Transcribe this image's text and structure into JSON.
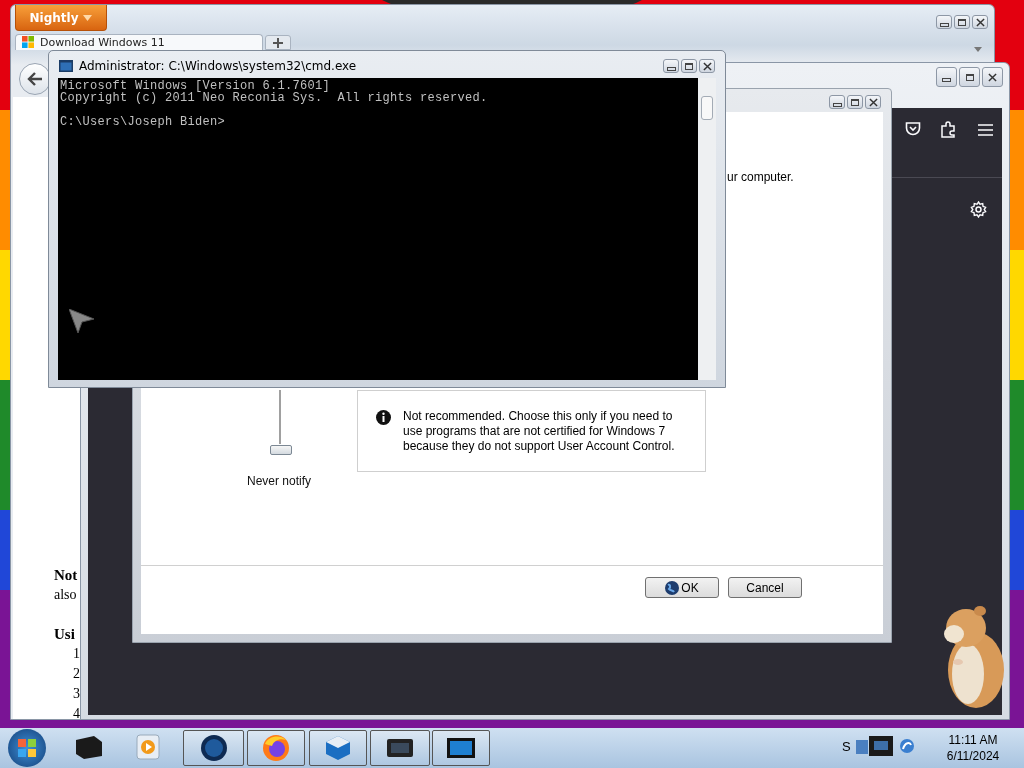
{
  "browser": {
    "menu_button": "Nightly",
    "tab": {
      "title": "Download Windows 11"
    },
    "page_text": [
      {
        "text": "Not",
        "kind": "heading"
      },
      {
        "text": "also",
        "kind": "body"
      },
      {
        "text": "Usi",
        "kind": "heading"
      },
      {
        "text": "1",
        "kind": "number"
      },
      {
        "text": "2",
        "kind": "number"
      },
      {
        "text": "3",
        "kind": "number"
      },
      {
        "text": "4",
        "kind": "number"
      }
    ]
  },
  "uac_dialog": {
    "visible_text": "ur computer.",
    "slider": {
      "label": "Never notify"
    },
    "info": "Not recommended. Choose this only if you need to use programs that are not certified for Windows 7 because they do not support User Account Control.",
    "buttons": [
      {
        "label": "OK",
        "kind": "shield"
      },
      {
        "label": "Cancel",
        "kind": "plain"
      }
    ]
  },
  "cmd": {
    "title": "Administrator: C:\\Windows\\system32\\cmd.exe",
    "output": [
      "Microsoft Windows [Version 6.1.7601]",
      "Copyright (c) 2011 Neo Reconia Sys.  All rights reserved."
    ],
    "prompt": "C:\\Users\\Joseph Biden>"
  },
  "taskbar": {
    "tray_label": "S",
    "time": "11:11 AM",
    "date": "6/11/2024"
  }
}
